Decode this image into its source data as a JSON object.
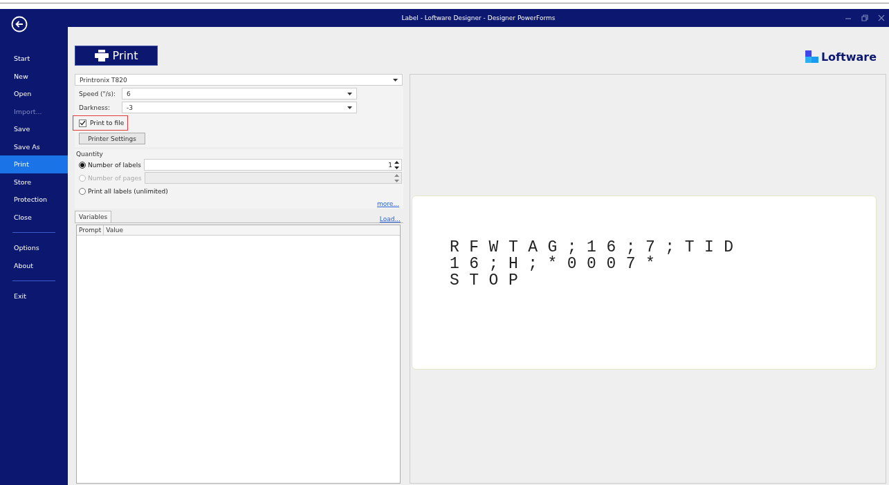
{
  "window": {
    "title": "Label - Loftware Designer - Designer PowerForms"
  },
  "sidebar": {
    "groups": [
      [
        {
          "label": "Start",
          "selected": false,
          "disabled": false
        },
        {
          "label": "New",
          "selected": false,
          "disabled": false
        },
        {
          "label": "Open",
          "selected": false,
          "disabled": false
        },
        {
          "label": "Import...",
          "selected": false,
          "disabled": true
        },
        {
          "label": "Save",
          "selected": false,
          "disabled": false
        },
        {
          "label": "Save As",
          "selected": false,
          "disabled": false
        },
        {
          "label": "Print",
          "selected": true,
          "disabled": false
        },
        {
          "label": "Store",
          "selected": false,
          "disabled": false
        },
        {
          "label": "Protection",
          "selected": false,
          "disabled": false
        },
        {
          "label": "Close",
          "selected": false,
          "disabled": false
        }
      ],
      [
        {
          "label": "Options",
          "selected": false,
          "disabled": false
        },
        {
          "label": "About",
          "selected": false,
          "disabled": false
        }
      ],
      [
        {
          "label": "Exit",
          "selected": false,
          "disabled": false
        }
      ]
    ]
  },
  "header": {
    "print_button": "Print",
    "logo": "Loftware"
  },
  "printer": {
    "value": "Printronix T820"
  },
  "settings": [
    {
      "label": "Speed (\"/s):",
      "value": "6"
    },
    {
      "label": "Darkness:",
      "value": "-3"
    }
  ],
  "print_to_file": {
    "label": "Print to file",
    "checked": true,
    "highlighted": true
  },
  "printer_settings_button": "Printer Settings",
  "quantity": {
    "title": "Quantity",
    "options": [
      {
        "label": "Number of labels",
        "selected": true,
        "disabled": false,
        "value": "1",
        "kind": "spinner"
      },
      {
        "label": "Number of pages",
        "selected": false,
        "disabled": true,
        "kind": "spinner"
      },
      {
        "label": "Print all labels (unlimited)",
        "selected": false,
        "disabled": false,
        "kind": "plain"
      }
    ],
    "more_link": "more..."
  },
  "variables": {
    "tab": "Variables",
    "load_link": "Load...",
    "columns": [
      "Prompt",
      "Value"
    ]
  },
  "preview": {
    "lines": [
      "RFWTAG;16;7;TID",
      "16;H;*0007*",
      "STOP"
    ]
  }
}
